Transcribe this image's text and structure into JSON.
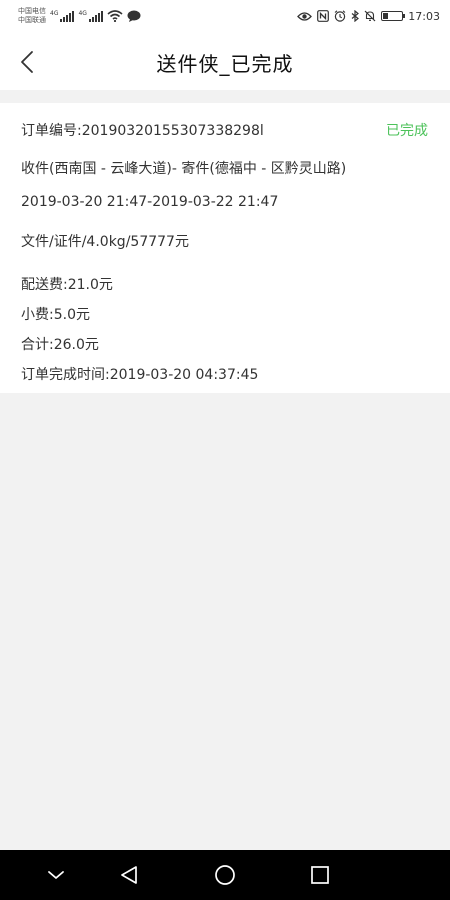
{
  "status_bar": {
    "carrier_1": "中国电信",
    "carrier_2": "中国联通",
    "network_1": "4G",
    "network_2": "4G",
    "time": "17:03",
    "battery_level": 0.3
  },
  "header": {
    "title": "送件侠_已完成"
  },
  "order": {
    "number": "订单编号:20190320155307338298l",
    "status": "已完成",
    "route": "收件(西南国 - 云峰大道)-  寄件(德福中 - 区黔灵山路)",
    "time_window": "2019-03-20 21:47-2019-03-22 21:47",
    "item": "文件/证件/4.0kg/57777元",
    "delivery_fee": "配送费:21.0元",
    "tip": "小费:5.0元",
    "total": "合计:26.0元",
    "completed_time": "订单完成时间:2019-03-20 04:37:45"
  }
}
